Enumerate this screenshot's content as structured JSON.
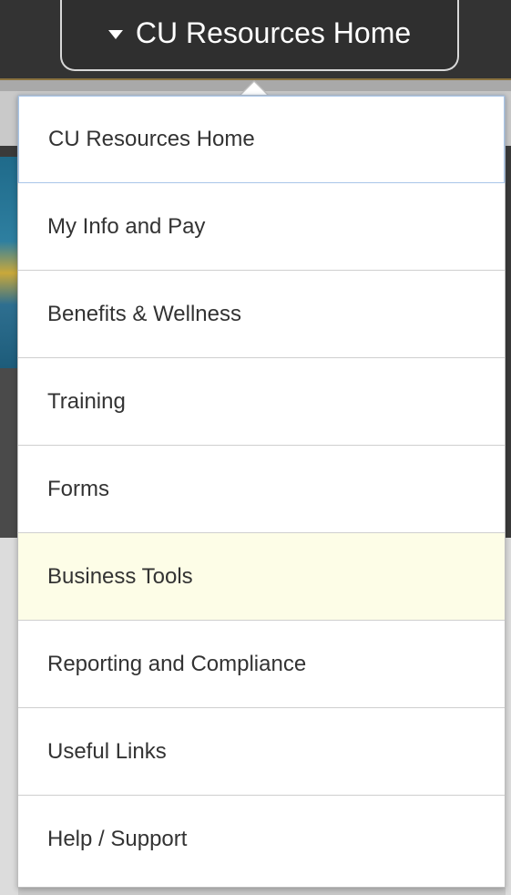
{
  "header": {
    "title": "CU Resources Home",
    "caret_icon": "caret-down-icon"
  },
  "menu": {
    "items": [
      {
        "label": "CU Resources Home",
        "state": "current"
      },
      {
        "label": "My Info and Pay"
      },
      {
        "label": "Benefits & Wellness"
      },
      {
        "label": "Training"
      },
      {
        "label": "Forms"
      },
      {
        "label": "Business Tools",
        "state": "hover"
      },
      {
        "label": "Reporting and Compliance"
      },
      {
        "label": "Useful Links"
      },
      {
        "label": "Help / Support"
      }
    ]
  },
  "colors": {
    "header_bg": "#333333",
    "accent_gold": "#8a7340",
    "hover_bg": "#fdfde7",
    "focus_border": "#a9c6e8"
  }
}
